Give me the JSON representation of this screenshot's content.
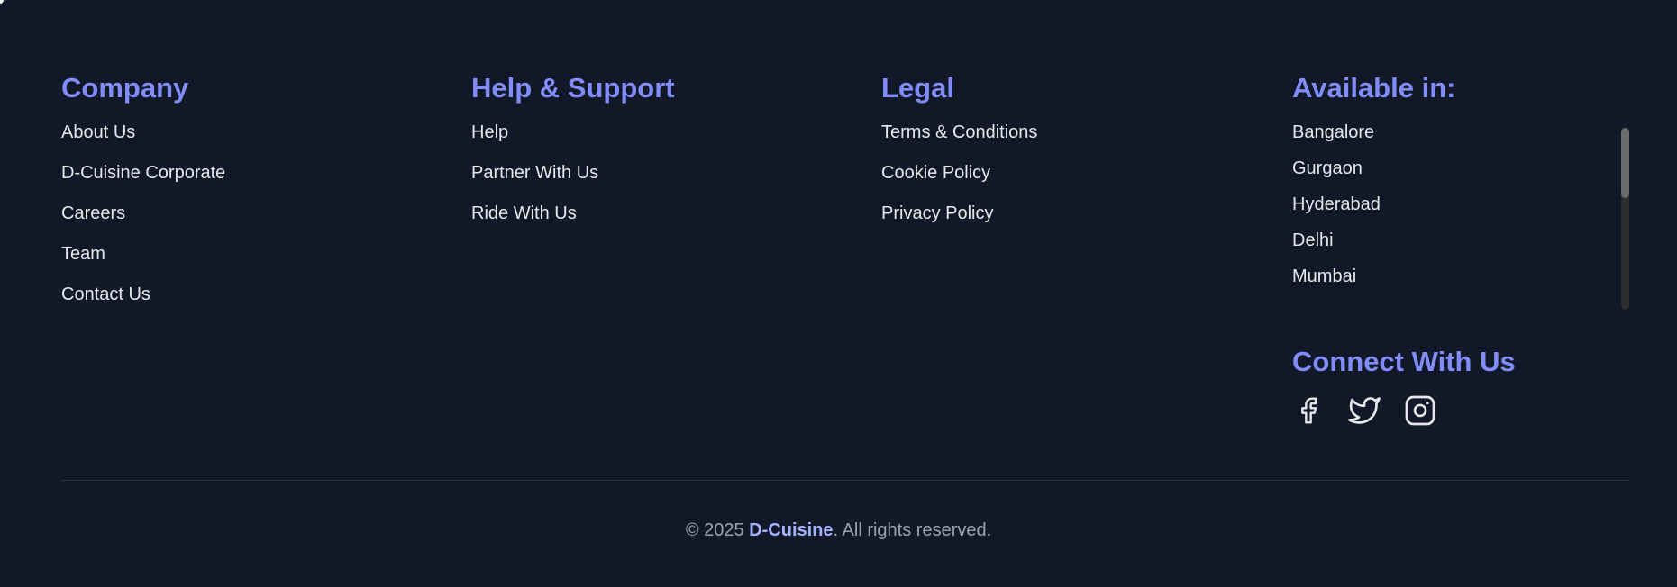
{
  "company": {
    "heading": "Company",
    "links": [
      "About Us",
      "D-Cuisine Corporate",
      "Careers",
      "Team",
      "Contact Us"
    ]
  },
  "help": {
    "heading": "Help & Support",
    "links": [
      "Help",
      "Partner With Us",
      "Ride With Us"
    ]
  },
  "legal": {
    "heading": "Legal",
    "links": [
      "Terms & Conditions",
      "Cookie Policy",
      "Privacy Policy"
    ]
  },
  "available": {
    "heading": "Available in:",
    "cities": [
      "Bangalore",
      "Gurgaon",
      "Hyderabad",
      "Delhi",
      "Mumbai"
    ]
  },
  "connect": {
    "heading": "Connect With Us",
    "icons": [
      "facebook-icon",
      "twitter-icon",
      "instagram-icon"
    ]
  },
  "copyright": {
    "prefix": "© 2025 ",
    "brand": "D-Cuisine",
    "suffix": ". All rights reserved."
  },
  "colors": {
    "background": "#111827",
    "accent": "#818cf8",
    "text": "#e5e7eb",
    "muted": "#9ca3af"
  }
}
